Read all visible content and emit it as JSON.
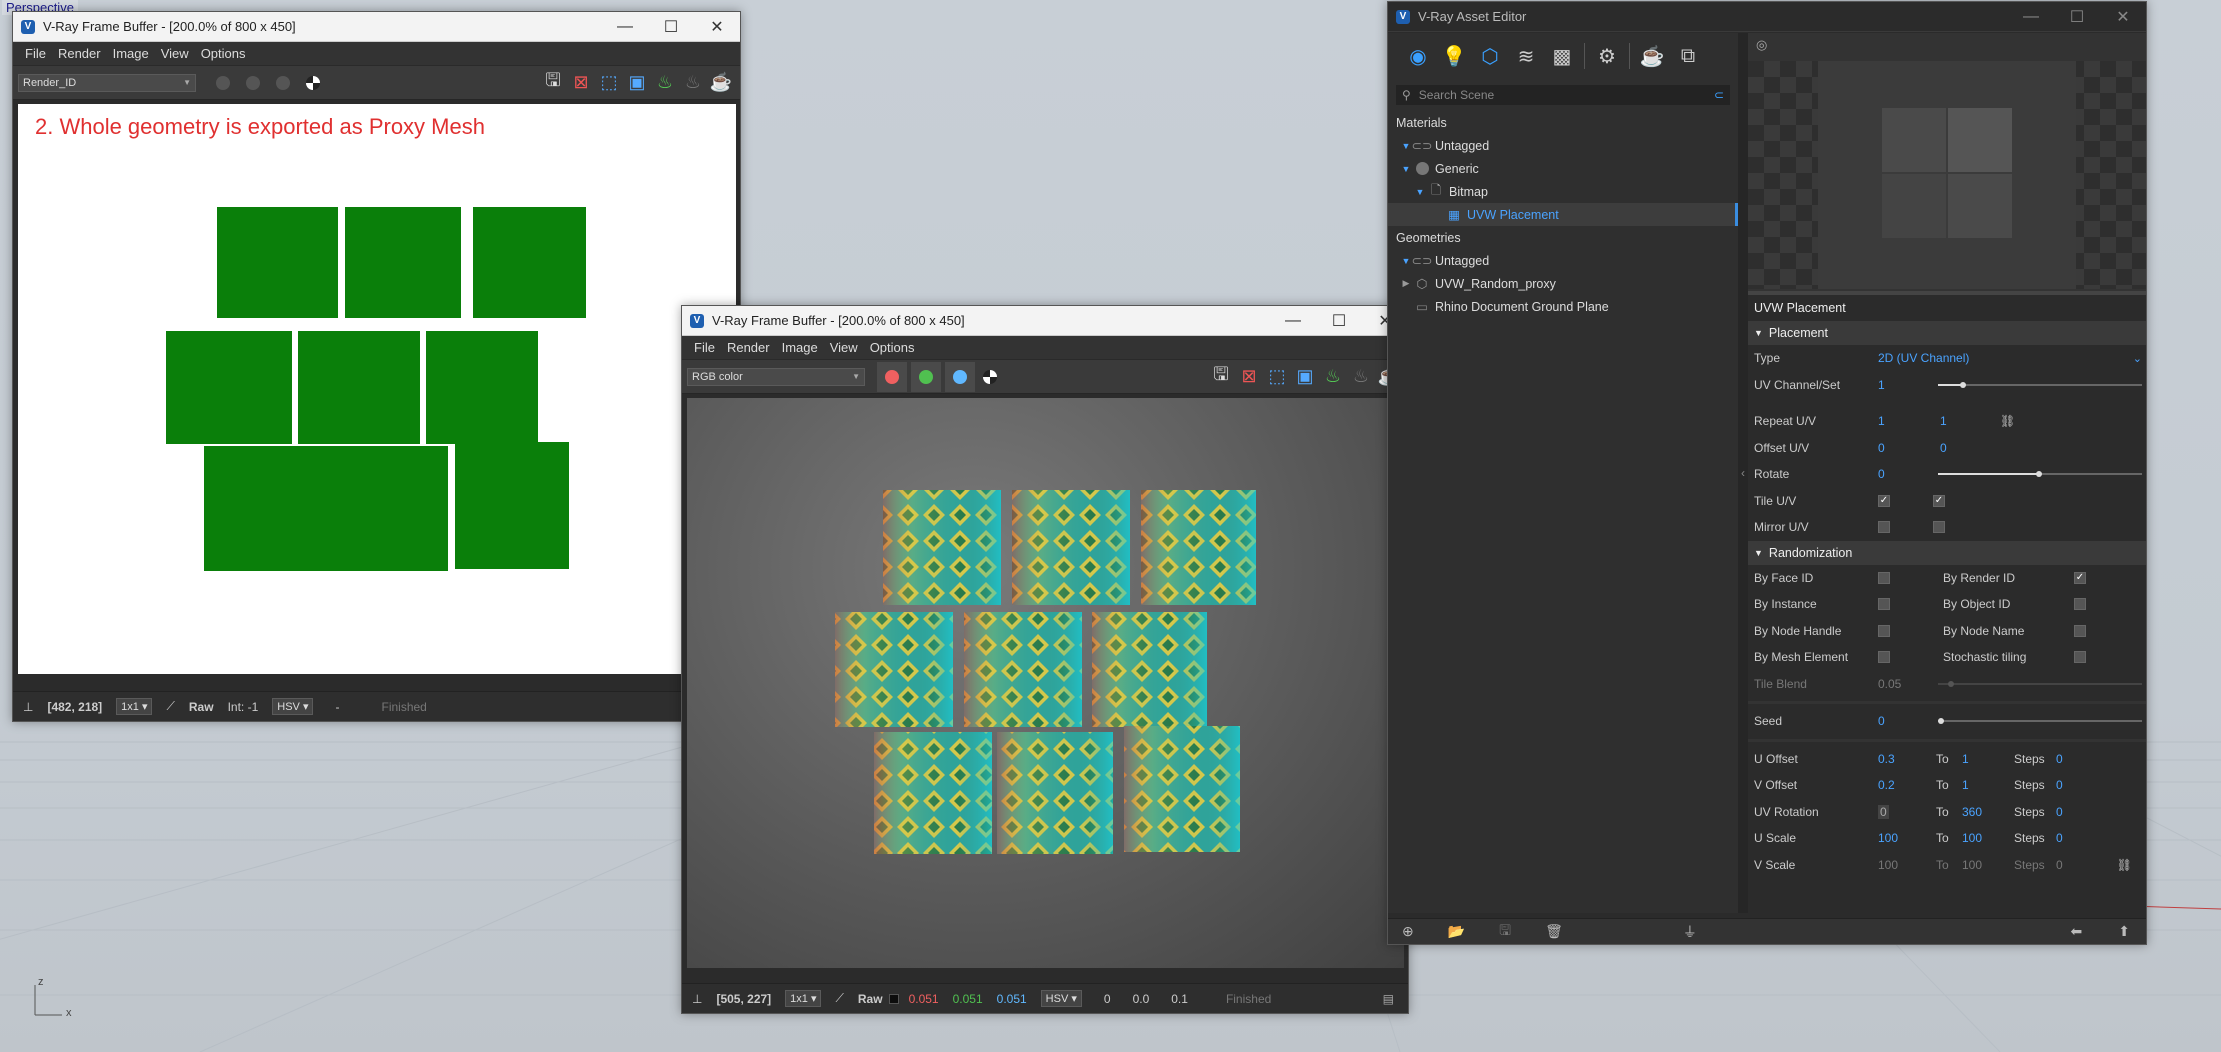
{
  "viewport": {
    "label": "Perspective",
    "axis_z": "z",
    "axis_x": "x"
  },
  "vfb1": {
    "title": "V-Ray Frame Buffer - [200.0% of 800 x 450]",
    "menu": [
      "File",
      "Render",
      "Image",
      "View",
      "Options"
    ],
    "channel_select": "Render_ID",
    "caption": "2. Whole geometry is exported as Proxy Mesh",
    "status": {
      "coords": "[482, 218]",
      "zoom": "1x1",
      "mode": "Raw",
      "int_label": "Int:",
      "int_value": "-1",
      "color_space": "HSV",
      "dash": "-",
      "state": "Finished"
    }
  },
  "vfb2": {
    "title": "V-Ray Frame Buffer - [200.0% of 800 x 450]",
    "menu": [
      "File",
      "Render",
      "Image",
      "View",
      "Options"
    ],
    "channel_select": "RGB color",
    "status": {
      "coords": "[505, 227]",
      "zoom": "1x1",
      "mode": "Raw",
      "r": "0.051",
      "g": "0.051",
      "b": "0.051",
      "color_space": "HSV",
      "h": "0",
      "s": "0.0",
      "v": "0.1",
      "state": "Finished"
    }
  },
  "asset_editor": {
    "title": "V-Ray Asset Editor",
    "search_placeholder": "Search Scene",
    "materials_header": "Materials",
    "geometries_header": "Geometries",
    "tree": {
      "mat_untagged": "Untagged",
      "generic": "Generic",
      "bitmap": "Bitmap",
      "uvw_placement": "UVW Placement",
      "geo_untagged": "Untagged",
      "uvw_random_proxy": "UVW_Random_proxy",
      "ground_plane": "Rhino Document Ground Plane"
    },
    "panel_title": "UVW Placement",
    "placement": {
      "header": "Placement",
      "type_label": "Type",
      "type_value": "2D (UV Channel)",
      "uv_channel_label": "UV Channel/Set",
      "uv_channel_value": "1",
      "repeat_label": "Repeat U/V",
      "repeat_u": "1",
      "repeat_v": "1",
      "offset_label": "Offset U/V",
      "offset_u": "0",
      "offset_v": "0",
      "rotate_label": "Rotate",
      "rotate_value": "0",
      "tile_label": "Tile U/V",
      "mirror_label": "Mirror U/V"
    },
    "randomization": {
      "header": "Randomization",
      "by_face_id": "By Face ID",
      "by_render_id": "By Render ID",
      "by_instance": "By Instance",
      "by_object_id": "By Object ID",
      "by_node_handle": "By Node Handle",
      "by_node_name": "By Node Name",
      "by_mesh_element": "By Mesh Element",
      "stochastic_tiling": "Stochastic tiling",
      "tile_blend_label": "Tile Blend",
      "tile_blend_value": "0.05",
      "seed_label": "Seed",
      "seed_value": "0",
      "to": "To",
      "steps": "Steps",
      "u_offset": {
        "label": "U Offset",
        "from": "0.3",
        "to": "1",
        "steps": "0"
      },
      "v_offset": {
        "label": "V Offset",
        "from": "0.2",
        "to": "1",
        "steps": "0"
      },
      "uv_rotation": {
        "label": "UV Rotation",
        "from": "0",
        "to": "360",
        "steps": "0"
      },
      "u_scale": {
        "label": "U Scale",
        "from": "100",
        "to": "100",
        "steps": "0"
      },
      "v_scale": {
        "label": "V Scale",
        "from": "100",
        "to": "100",
        "steps": "0"
      }
    }
  }
}
